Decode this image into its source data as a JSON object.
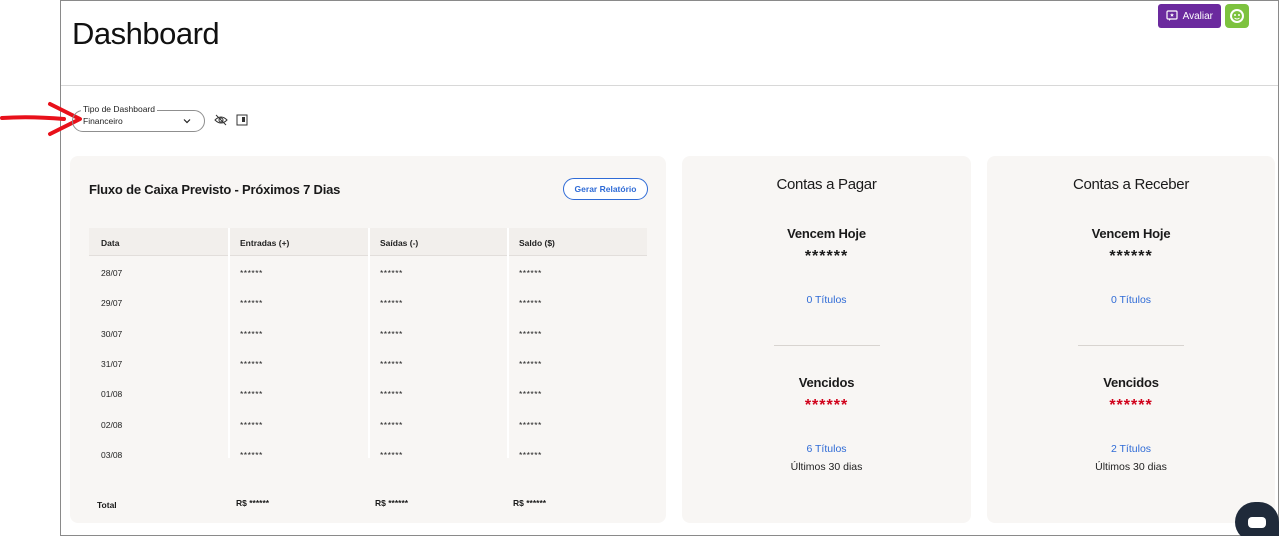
{
  "page": {
    "title": "Dashboard"
  },
  "header": {
    "avaliar_label": "Avaliar"
  },
  "filter": {
    "legend": "Tipo de Dashboard",
    "selected": "Financeiro"
  },
  "flow": {
    "title": "Fluxo de Caixa Previsto - Próximos 7 Dias",
    "report_button": "Gerar Relatório",
    "columns": [
      "Data",
      "Entradas (+)",
      "Saídas (-)",
      "Saldo ($)"
    ],
    "rows": [
      [
        "28/07",
        "******",
        "******",
        "******"
      ],
      [
        "29/07",
        "******",
        "******",
        "******"
      ],
      [
        "30/07",
        "******",
        "******",
        "******"
      ],
      [
        "31/07",
        "******",
        "******",
        "******"
      ],
      [
        "01/08",
        "******",
        "******",
        "******"
      ],
      [
        "02/08",
        "******",
        "******",
        "******"
      ],
      [
        "03/08",
        "******",
        "******",
        "******"
      ]
    ],
    "total": {
      "label": "Total",
      "entradas": "R$ ******",
      "saidas": "R$ ******",
      "saldo": "R$ ******"
    }
  },
  "pagar": {
    "title": "Contas a Pagar",
    "today_label": "Vencem Hoje",
    "today_value": "******",
    "today_link": "0 Títulos",
    "overdue_label": "Vencidos",
    "overdue_value": "******",
    "overdue_link": "6 Títulos",
    "overdue_note": "Últimos 30 dias"
  },
  "receber": {
    "title": "Contas a Receber",
    "today_label": "Vencem Hoje",
    "today_value": "******",
    "today_link": "0 Títulos",
    "overdue_label": "Vencidos",
    "overdue_value": "******",
    "overdue_link": "2 Títulos",
    "overdue_note": "Últimos 30 dias"
  },
  "colors": {
    "brand_purple": "#6b2a9e",
    "brand_green": "#7dc23f",
    "link_blue": "#2f6bd6",
    "overdue_red": "#d0021b",
    "annotation_red": "#e8101a"
  }
}
